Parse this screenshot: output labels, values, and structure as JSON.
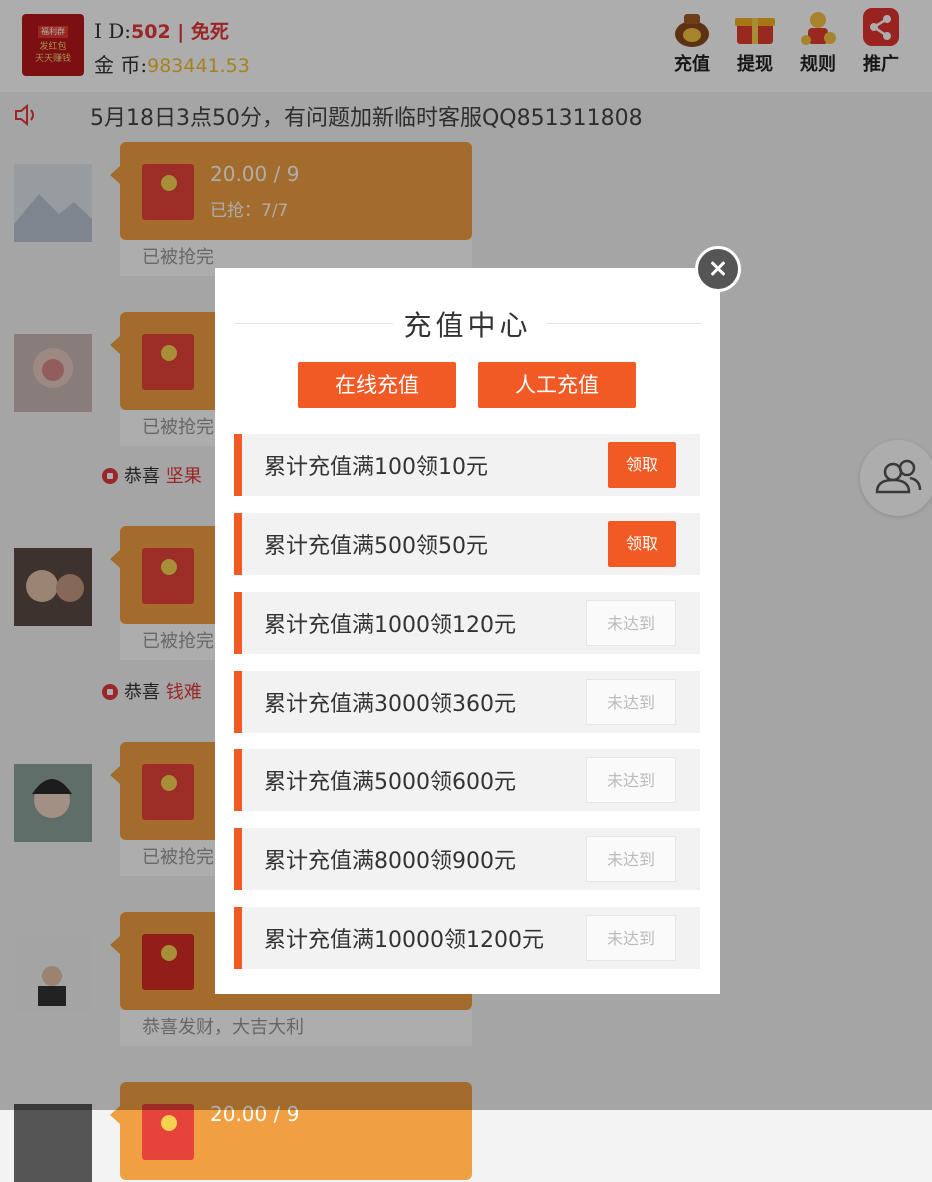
{
  "header": {
    "logo_text_top": "福利群",
    "logo_text_line1": "发红包",
    "logo_text_line2": "天天赚钱",
    "id_label": "I D:",
    "id_value": "502 | 免死",
    "gold_label": "金 币:",
    "gold_value": "983441.53",
    "actions": [
      {
        "label": "充值",
        "icon": "money-bag-icon"
      },
      {
        "label": "提现",
        "icon": "gift-box-icon"
      },
      {
        "label": "规则",
        "icon": "coin-person-icon"
      },
      {
        "label": "推广",
        "icon": "share-icon"
      }
    ]
  },
  "notice": {
    "icon": "speaker-icon",
    "text": "5月18日3点50分，有问题加新临时客服QQ851311808"
  },
  "chat": {
    "first_packet": {
      "amount": "20.00 / 9",
      "status": "已抢：7/7"
    },
    "messages_below": [
      "已被抢完",
      "已被抢完",
      "已被抢完",
      "已被抢完",
      "恭喜发财，大吉大利"
    ],
    "congrats": [
      {
        "prefix": "恭喜",
        "name": "坚果"
      },
      {
        "prefix": "恭喜",
        "name": "钱难"
      }
    ],
    "last_packet_amount": "20.00 / 9"
  },
  "modal": {
    "title": "充值中心",
    "tabs": [
      "在线充值",
      "人工充值"
    ],
    "rows": [
      {
        "text": "累计充值满100领10元",
        "button": "领取",
        "state": "claim"
      },
      {
        "text": "累计充值满500领50元",
        "button": "领取",
        "state": "claim"
      },
      {
        "text": "累计充值满1000领120元",
        "button": "未达到",
        "state": "unmet"
      },
      {
        "text": "累计充值满3000领360元",
        "button": "未达到",
        "state": "unmet"
      },
      {
        "text": "累计充值满5000领600元",
        "button": "未达到",
        "state": "unmet"
      },
      {
        "text": "累计充值满8000领900元",
        "button": "未达到",
        "state": "unmet"
      },
      {
        "text": "累计充值满10000领1200元",
        "button": "未达到",
        "state": "unmet"
      }
    ]
  },
  "colors": {
    "accent": "#f25a25",
    "bubble": "#f09f43",
    "red": "#e4393c"
  }
}
